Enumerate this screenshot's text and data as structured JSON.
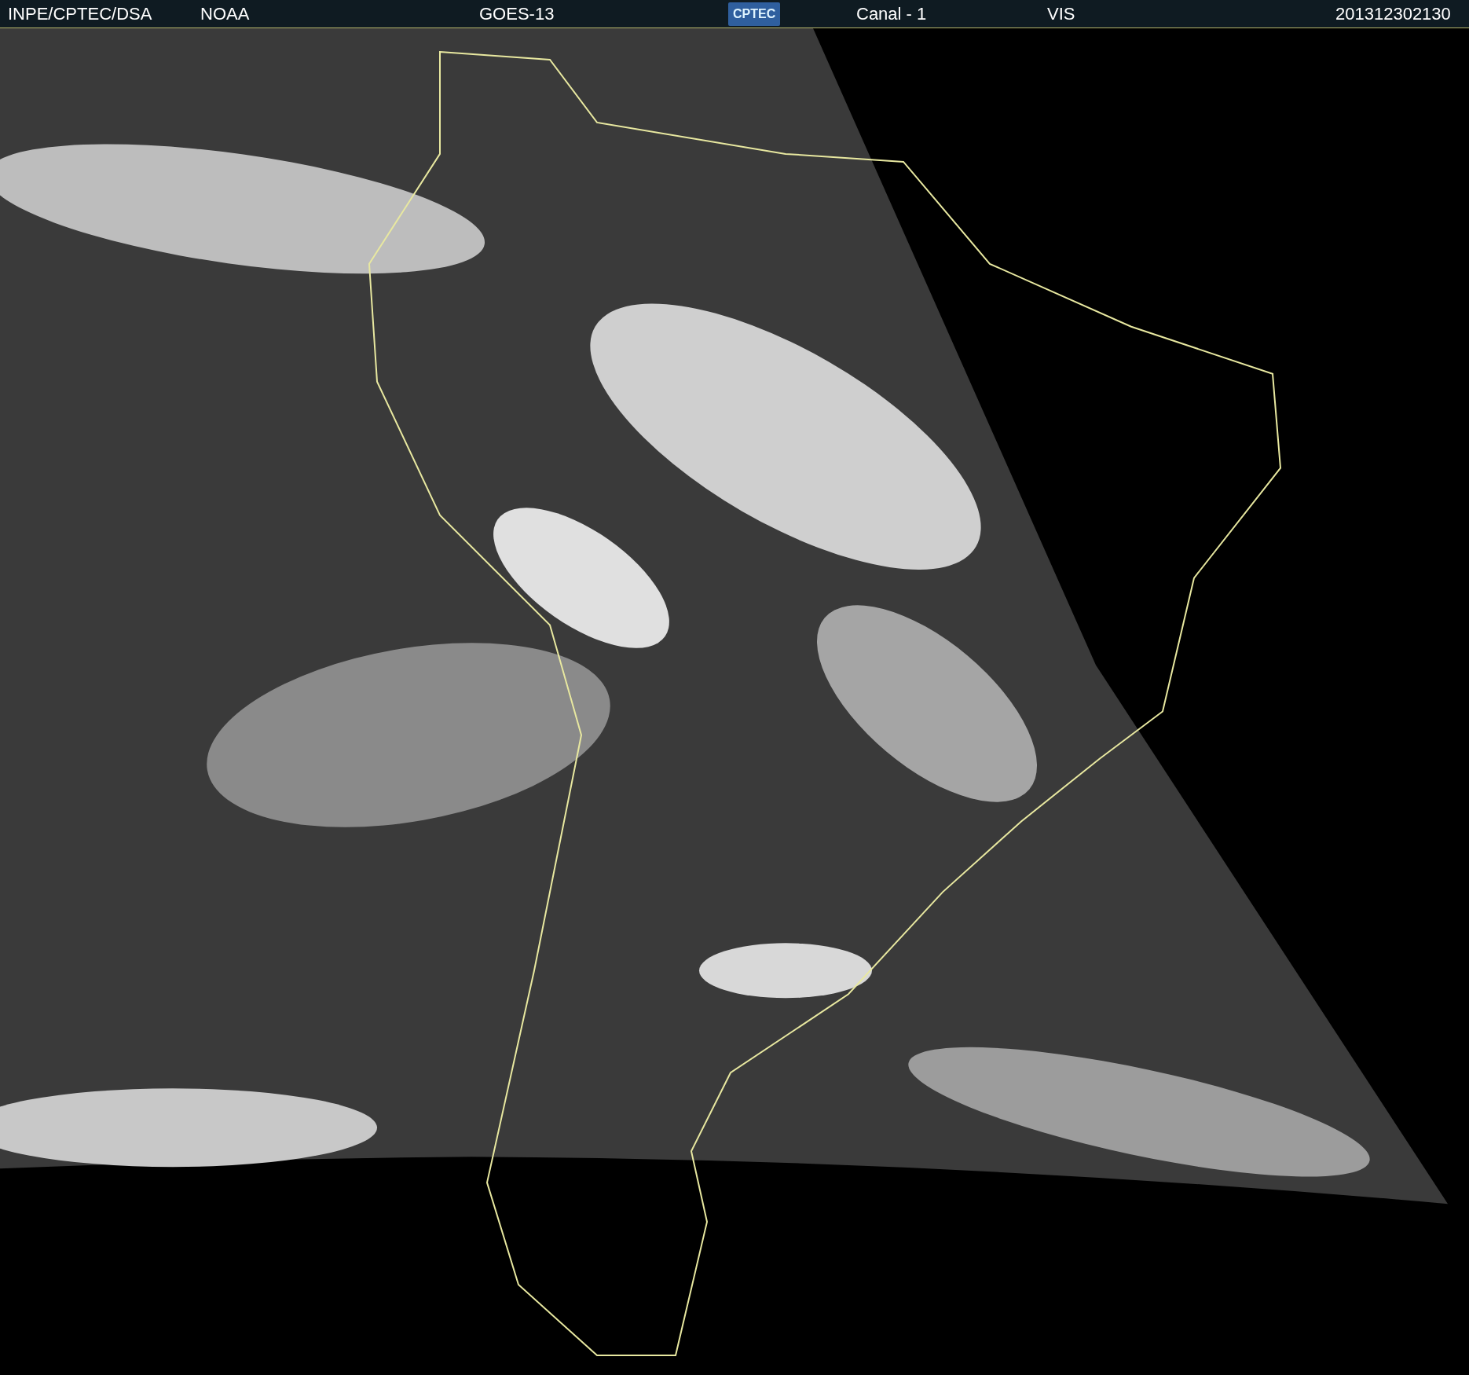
{
  "header": {
    "items": [
      {
        "kind": "text",
        "text": "INPE/CPTEC/DSA"
      },
      {
        "kind": "text",
        "text": "NOAA"
      },
      {
        "kind": "text",
        "text": "GOES-13"
      },
      {
        "kind": "logo",
        "text": "CPTEC"
      },
      {
        "kind": "text",
        "text": "Canal - 1"
      },
      {
        "kind": "text",
        "text": "VIS"
      },
      {
        "kind": "text",
        "text": "201312302130"
      }
    ]
  }
}
